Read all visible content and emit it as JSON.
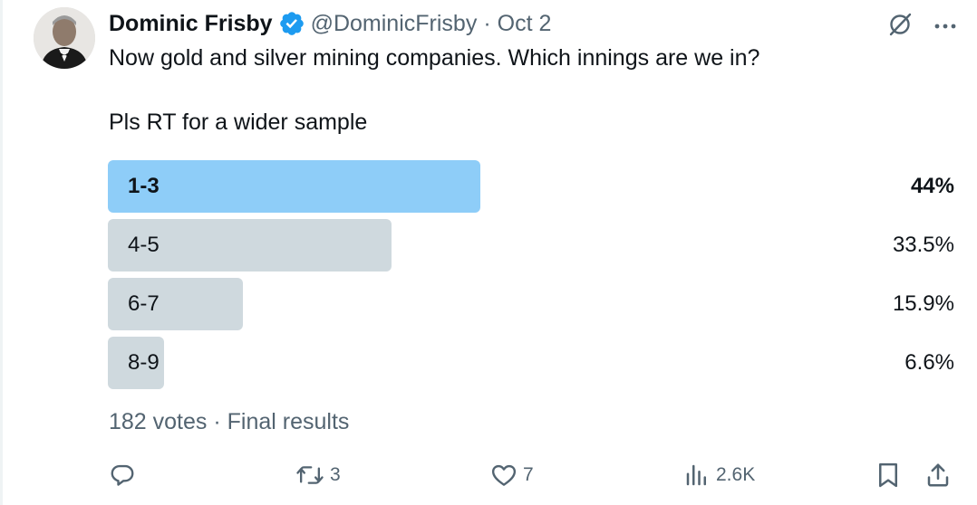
{
  "tweet": {
    "author_name": "Dominic Frisby",
    "handle": "@DominicFrisby",
    "separator": "·",
    "date": "Oct 2",
    "text_line1": "Now gold and silver mining companies. Which innings are we in?",
    "text_line2": "Pls RT for a wider sample"
  },
  "poll": {
    "options": [
      {
        "label": "1-3",
        "percent_text": "44%",
        "percent": 44.0,
        "winner": true
      },
      {
        "label": "4-5",
        "percent_text": "33.5%",
        "percent": 33.5,
        "winner": false
      },
      {
        "label": "6-7",
        "percent_text": "15.9%",
        "percent": 15.9,
        "winner": false
      },
      {
        "label": "8-9",
        "percent_text": "6.6%",
        "percent": 6.6,
        "winner": false
      }
    ],
    "footer": "182 votes · Final results",
    "colors": {
      "winner": "#8ecdf8",
      "other": "#cfd9de"
    }
  },
  "actions": {
    "reply": {
      "icon": "reply-icon",
      "count": ""
    },
    "retweet": {
      "icon": "retweet-icon",
      "count": "3"
    },
    "like": {
      "icon": "heart-icon",
      "count": "7"
    },
    "views": {
      "icon": "views-icon",
      "count": "2.6K"
    },
    "bookmark": {
      "icon": "bookmark-icon"
    },
    "share": {
      "icon": "share-icon"
    }
  },
  "colors": {
    "text": "#0f1419",
    "secondary": "#536471",
    "verified": "#1d9bf0"
  }
}
